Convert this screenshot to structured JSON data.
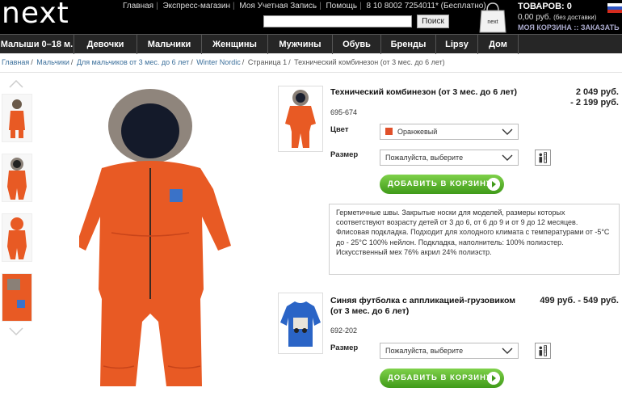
{
  "header": {
    "logo": "next",
    "top_links": [
      "Главная",
      "Экспресс-магазин",
      "Моя Учетная Запись",
      "Помощь",
      "8 10 8002 7254011* (Бесплатно)"
    ],
    "search_placeholder": "",
    "search_button": "Поиск",
    "bag_label": "next",
    "cart_items": "ТОВАРОВ: 0",
    "cart_price": "0,00 руб.",
    "cart_price_note": "(без доставки)",
    "cart_links": "МОЯ КОРЗИНА :: ЗАКАЗАТЬ"
  },
  "nav": {
    "items": [
      "Малыши 0–18 м.",
      "Девочки",
      "Мальчики",
      "Женщины",
      "Мужчины",
      "Обувь",
      "Бренды",
      "Lipsy",
      "Дом"
    ]
  },
  "breadcrumb": {
    "items": [
      "Главная",
      "Мальчики",
      "Для мальчиков от 3 мес. до 6 лет",
      "Winter Nordic",
      "Страница 1",
      "Технический комбинезон (от 3 мес. до 6 лет)"
    ]
  },
  "product1": {
    "title": "Технический комбинезон (от 3 мес. до 6 лет)",
    "code": "695-674",
    "price_line1": "2 049 руб.",
    "price_line2": "- 2 199 руб.",
    "color_label": "Цвет",
    "color_value": "Оранжевый",
    "color_swatch": "#e0502a",
    "size_label": "Размер",
    "size_value": "Пожалуйста, выберите",
    "add_button": "ДОБАВИТЬ В КОРЗИНУ",
    "description": "Герметичные швы. Закрытые носки для моделей, размеры которых соответствуют возрасту детей от 3 до 6, от 6 до 9 и от 9 до 12 месяцев. Флисовая подкладка. Подходит для холодного климата с температурами от -5°С до - 25°С 100% нейлон. Подкладка, наполнитель: 100% полиэстер. Искусственный мех 76% акрил 24% полиэстр."
  },
  "product2": {
    "title": "Синяя футболка с аппликацией-грузовиком (от 3 мес. до 6 лет)",
    "code": "692-202",
    "price": "499 руб. - 549 руб.",
    "size_label": "Размер",
    "size_value": "Пожалуйста, выберите",
    "add_button": "ДОБАВИТЬ В КОРЗИНУ"
  },
  "colors": {
    "accent_orange": "#e85a24",
    "button_green": "#4aa81f",
    "header_black": "#000000",
    "nav_gray": "#262626",
    "link_blue": "#3b6f9b"
  }
}
